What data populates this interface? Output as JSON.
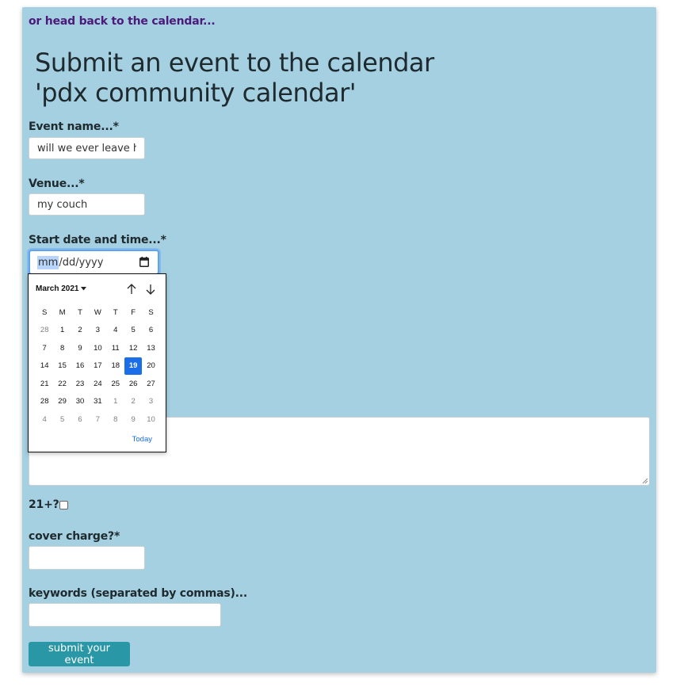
{
  "nav": {
    "back_link": "or head back to the calendar..."
  },
  "header": {
    "title_line1": "Submit an event to the calendar",
    "title_line2": "'pdx community calendar'"
  },
  "form": {
    "event_name": {
      "label": "Event name...*",
      "value": "will we ever leave home"
    },
    "venue": {
      "label": "Venue...*",
      "value": "my couch"
    },
    "start_datetime": {
      "label": "Start date and time...*",
      "seg_month": "mm",
      "sep1": "/",
      "seg_day": "dd",
      "sep2": "/",
      "seg_year": "yyyy"
    },
    "age21": {
      "label": "21+?",
      "checked": false
    },
    "cover_charge": {
      "label": "cover charge?*",
      "value": ""
    },
    "keywords": {
      "label": "keywords (separated by commas)...",
      "value": ""
    },
    "submit_label": "submit your event"
  },
  "datepicker": {
    "month_label": "March 2021",
    "weekdays": [
      "S",
      "M",
      "T",
      "W",
      "T",
      "F",
      "S"
    ],
    "days": [
      [
        "28",
        "1",
        "2",
        "3",
        "4",
        "5",
        "6"
      ],
      [
        "7",
        "8",
        "9",
        "10",
        "11",
        "12",
        "13"
      ],
      [
        "14",
        "15",
        "16",
        "17",
        "18",
        "19",
        "20"
      ],
      [
        "21",
        "22",
        "23",
        "24",
        "25",
        "26",
        "27"
      ],
      [
        "28",
        "29",
        "30",
        "31",
        "1",
        "2",
        "3"
      ],
      [
        "4",
        "5",
        "6",
        "7",
        "8",
        "9",
        "10"
      ]
    ],
    "selected_day": "19",
    "today_label": "Today"
  },
  "colors": {
    "panel_bg": "#a5d0e1",
    "accent_blue": "#1a6ee9",
    "submit_bg": "#2a97a6",
    "link_color": "#4b1a7a"
  },
  "icons": [
    "calendar-icon",
    "arrow-up-icon",
    "arrow-down-icon",
    "caret-down-icon",
    "resize-grip-icon"
  ]
}
